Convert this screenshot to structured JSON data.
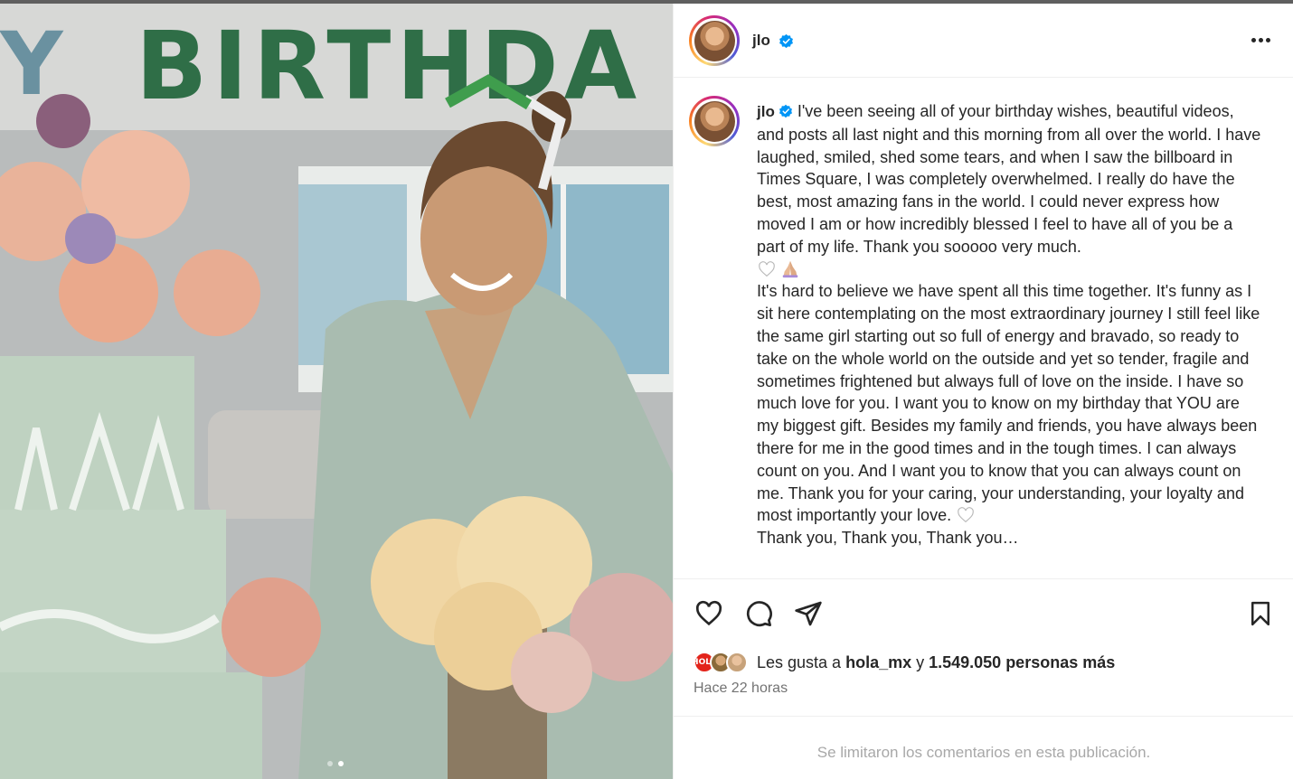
{
  "post": {
    "username": "jlo",
    "verified": true,
    "more_options_icon": "more-horizontal-icon"
  },
  "caption": {
    "username": "jlo",
    "paragraph_1": "I've been seeing all of your birthday wishes, beautiful videos, and posts all last night and this morning from all over the world. I have laughed, smiled, shed some tears, and when I saw the billboard in Times Square, I was completely overwhelmed. I really do have the best, most amazing fans in the world. I could never express how moved I am or how incredibly blessed I feel to have all of you be a part of my life. Thank you sooooo very much.",
    "emoji_1": "white-heart-icon",
    "emoji_2": "praying-hands-icon",
    "paragraph_2": "It's hard to believe we have spent all this time together. It's funny as I sit here contemplating on the most extraordinary journey I still feel like the same girl starting out so full of energy and bravado, so ready to take on the whole world on the outside and yet so tender, fragile and sometimes frightened but always full of love on the inside. I have so much love for you. I want you to know on my birthday that YOU are my biggest gift. Besides my family and friends, you have always been there for me in the good times and in the tough times. I can always count on you. And I want you to know that you can always count on me. Thank you for your caring, your understanding, your loyalty and most importantly your love.",
    "paragraph_3": "Thank you, Thank you, Thank you…"
  },
  "photo": {
    "balloon_text": "BIRTHDA",
    "balloon_text_left": "Y",
    "carousel": {
      "total": 2,
      "active": 2
    }
  },
  "actions": {
    "like_icon": "heart-icon",
    "comment_icon": "comment-icon",
    "share_icon": "send-icon",
    "save_icon": "bookmark-icon"
  },
  "likes": {
    "prefix": "Les gusta a",
    "first_liker": "hola_mx",
    "conjunction": "y",
    "others": "1.549.050 personas más",
    "liker_badge": "¡HOLA!"
  },
  "time_ago": "Hace 22 horas",
  "comments_notice": "Se limitaron los comentarios en esta publicación."
}
